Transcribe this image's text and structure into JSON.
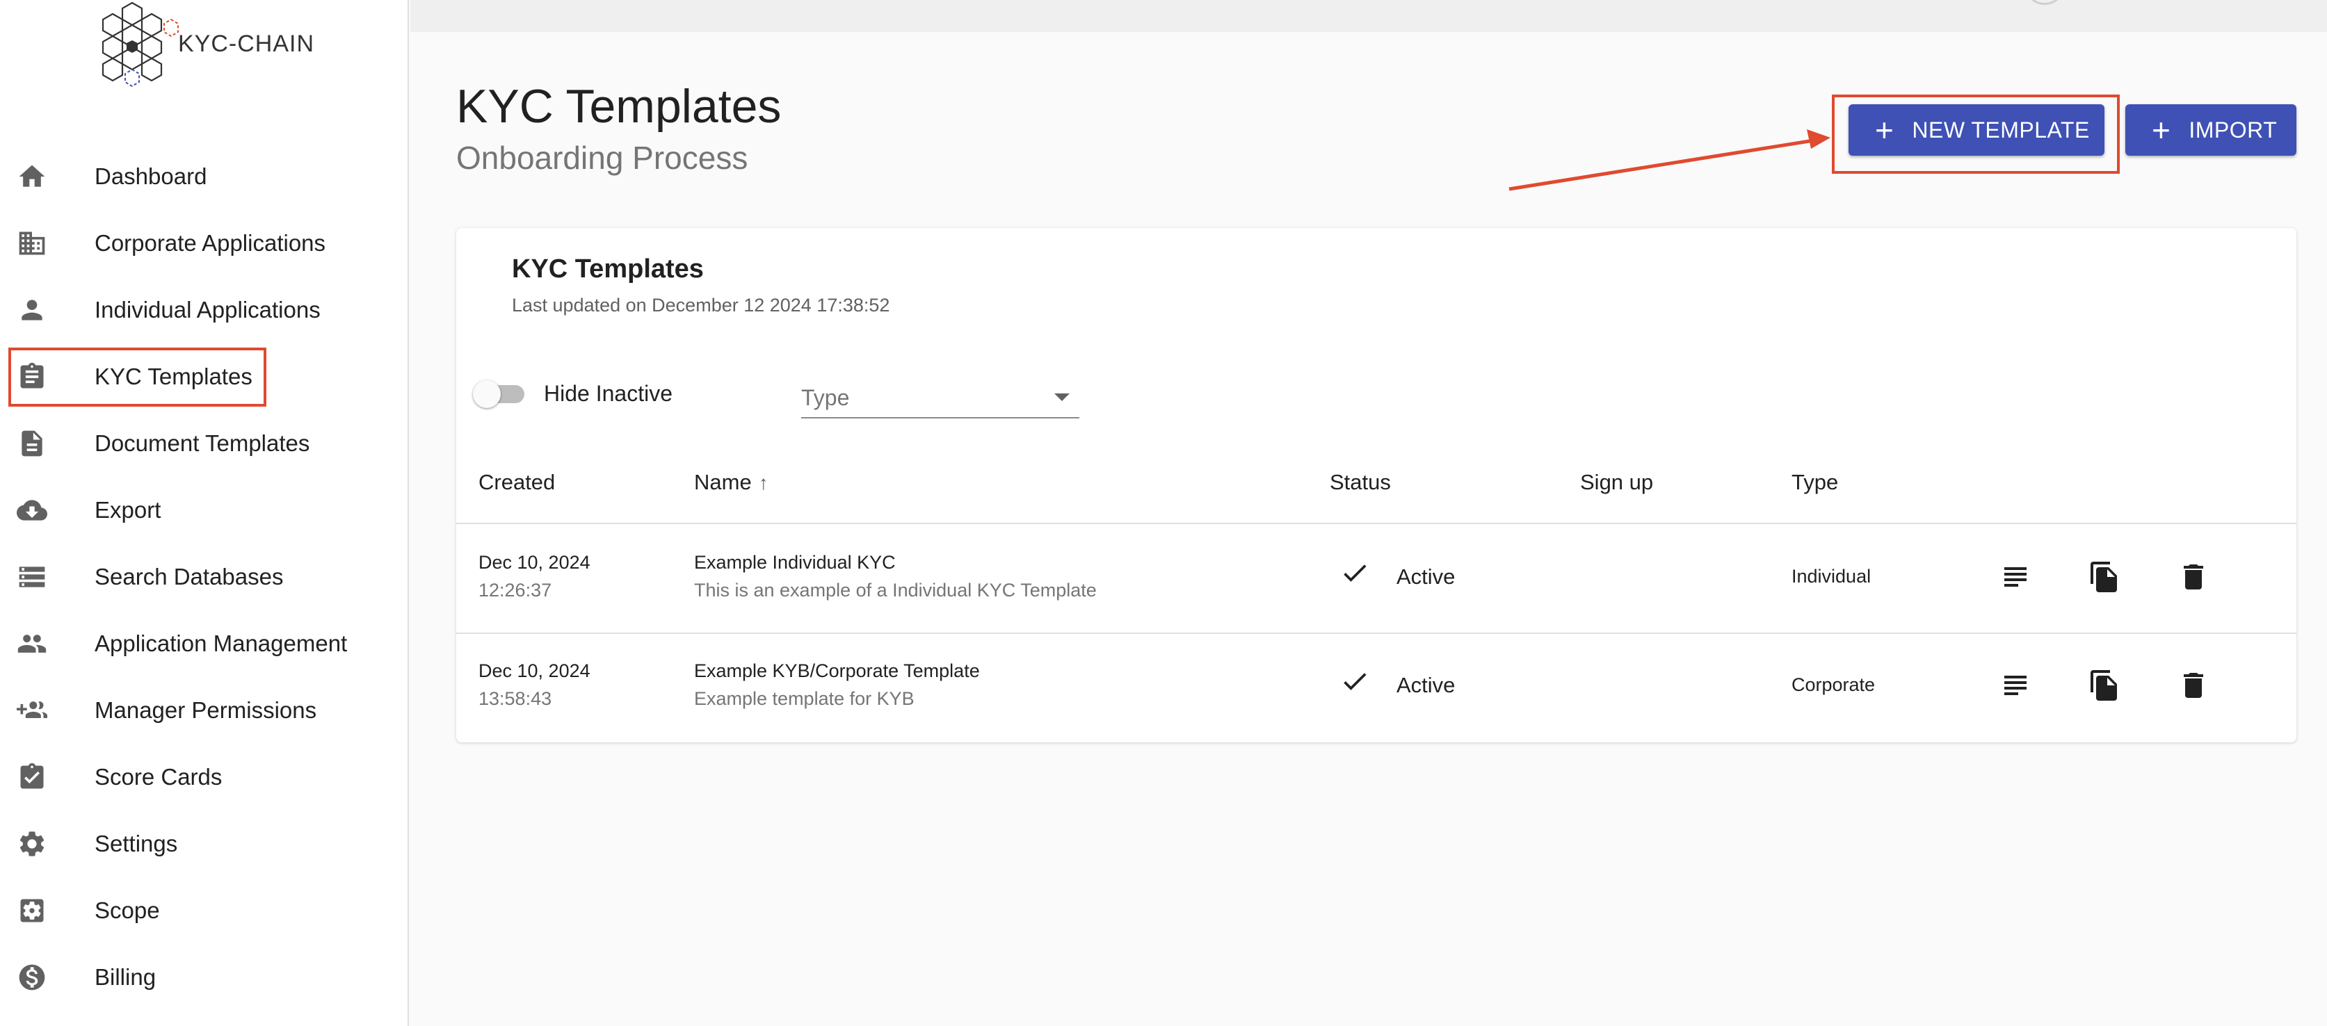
{
  "brand": {
    "name": "KYC-CHAIN"
  },
  "sidebar": {
    "items": [
      {
        "label": "Dashboard",
        "icon": "home-icon"
      },
      {
        "label": "Corporate Applications",
        "icon": "building-icon"
      },
      {
        "label": "Individual Applications",
        "icon": "person-icon"
      },
      {
        "label": "KYC Templates",
        "icon": "clipboard-icon",
        "active": true
      },
      {
        "label": "Document Templates",
        "icon": "document-icon"
      },
      {
        "label": "Export",
        "icon": "cloud-download-icon"
      },
      {
        "label": "Search Databases",
        "icon": "database-icon"
      },
      {
        "label": "Application Management",
        "icon": "people-icon"
      },
      {
        "label": "Manager Permissions",
        "icon": "group-add-icon"
      },
      {
        "label": "Score Cards",
        "icon": "assignment-check-icon"
      },
      {
        "label": "Settings",
        "icon": "gear-icon"
      },
      {
        "label": "Scope",
        "icon": "settings-box-icon"
      },
      {
        "label": "Billing",
        "icon": "dollar-circle-icon"
      }
    ]
  },
  "header": {
    "title": "KYC Templates",
    "subtitle": "Onboarding Process",
    "new_template_label": "NEW TEMPLATE",
    "import_label": "IMPORT"
  },
  "card": {
    "title": "KYC Templates",
    "last_updated": "Last updated on December 12 2024 17:38:52",
    "filters": {
      "hide_inactive_label": "Hide Inactive",
      "hide_inactive_on": false,
      "type_placeholder": "Type"
    },
    "columns": {
      "created": "Created",
      "name": "Name",
      "status": "Status",
      "signup": "Sign up",
      "type": "Type"
    },
    "rows": [
      {
        "date": "Dec 10, 2024",
        "time": "12:26:37",
        "name": "Example Individual KYC",
        "description": "This is an example of a Individual KYC Template",
        "status": "Active",
        "signup": "",
        "type": "Individual"
      },
      {
        "date": "Dec 10, 2024",
        "time": "13:58:43",
        "name": "Example KYB/Corporate Template",
        "description": "Example template for KYB",
        "status": "Active",
        "signup": "",
        "type": "Corporate"
      }
    ]
  },
  "colors": {
    "primary": "#3f51b5",
    "annotation": "#e04a2f"
  }
}
